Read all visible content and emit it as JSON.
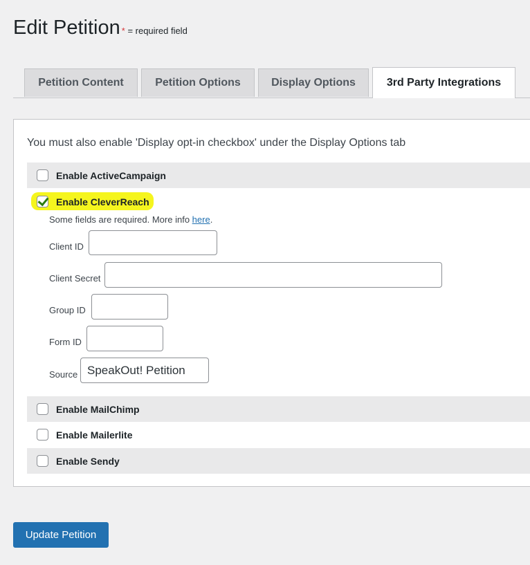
{
  "header": {
    "title": "Edit Petition",
    "required_star": "*",
    "required_note": " = required field"
  },
  "tabs": [
    {
      "label": "Petition Content",
      "active": false
    },
    {
      "label": "Petition Options",
      "active": false
    },
    {
      "label": "Display Options",
      "active": false
    },
    {
      "label": "3rd Party Integrations",
      "active": true
    }
  ],
  "panel": {
    "notice": "You must also enable 'Display opt-in checkbox' under the Display Options tab",
    "integrations": [
      {
        "label": "Enable ActiveCampaign",
        "checked": false
      },
      {
        "label": "Enable CleverReach",
        "checked": true
      },
      {
        "label": "Enable MailChimp",
        "checked": false
      },
      {
        "label": "Enable Mailerlite",
        "checked": false
      },
      {
        "label": "Enable Sendy",
        "checked": false
      }
    ],
    "cleverreach": {
      "info_text": "Some fields are required. More info ",
      "info_link": "here",
      "info_end": ".",
      "fields": [
        {
          "label": "Client ID",
          "value": ""
        },
        {
          "label": "Client Secret",
          "value": ""
        },
        {
          "label": "Group ID",
          "value": ""
        },
        {
          "label": "Form ID",
          "value": ""
        },
        {
          "label": "Source",
          "value": "SpeakOut! Petition"
        }
      ]
    }
  },
  "actions": {
    "update_label": "Update Petition"
  },
  "colors": {
    "accent": "#2271b1",
    "highlight": "#f5f51e",
    "checkmark": "#2a7a11",
    "required": "#d63638"
  }
}
